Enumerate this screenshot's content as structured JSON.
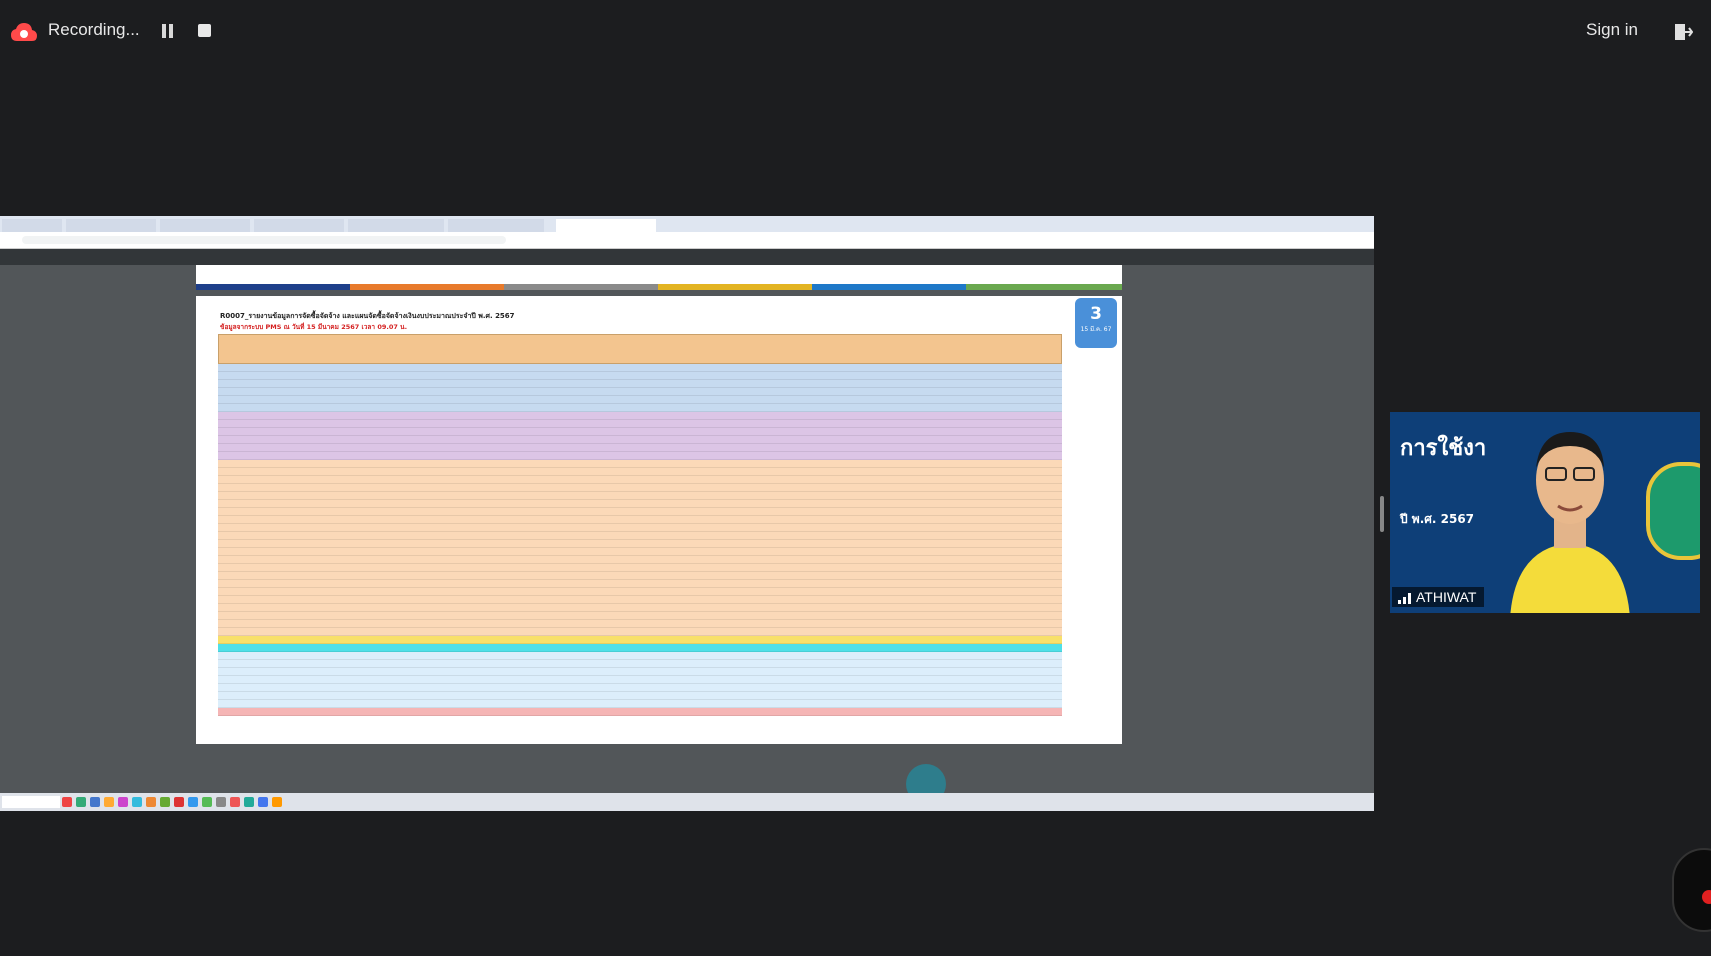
{
  "topbar": {
    "recording_label": "Recording...",
    "sign_in_label": "Sign in"
  },
  "shared_screen": {
    "slide": {
      "page_number": "3",
      "date_label": "15 มี.ค. 67"
    },
    "report": {
      "title": "R0007_รายงานข้อมูลการจัดซื้อจัดจ้าง และแผนจัดซื้อจัดจ้างเงินงบประมาณประจำปี พ.ศ. 2567",
      "subtitle": "ข้อมูลจากระบบ PMS ณ วันที่ 15 มีนาคม 2567 เวลา 09.07 น."
    },
    "colors": {
      "header_row": "#f3c58f",
      "section_blue": "#c6daf0",
      "section_purple": "#dcc5e6",
      "section_peach": "#fbd9b8",
      "section_cyan": "#4fe0e8",
      "total_yellow": "#f8e06a",
      "total_pink": "#f5b5b5"
    }
  },
  "participant": {
    "name": "ATHIWAT",
    "banner_headline": "การใช้งา",
    "banner_year": "ปี พ.ศ. 2567"
  },
  "icons": {
    "recording": "cloud-recording-icon",
    "pause": "pause-icon",
    "stop": "stop-icon",
    "leave": "leave-icon",
    "signal": "signal-icon"
  }
}
